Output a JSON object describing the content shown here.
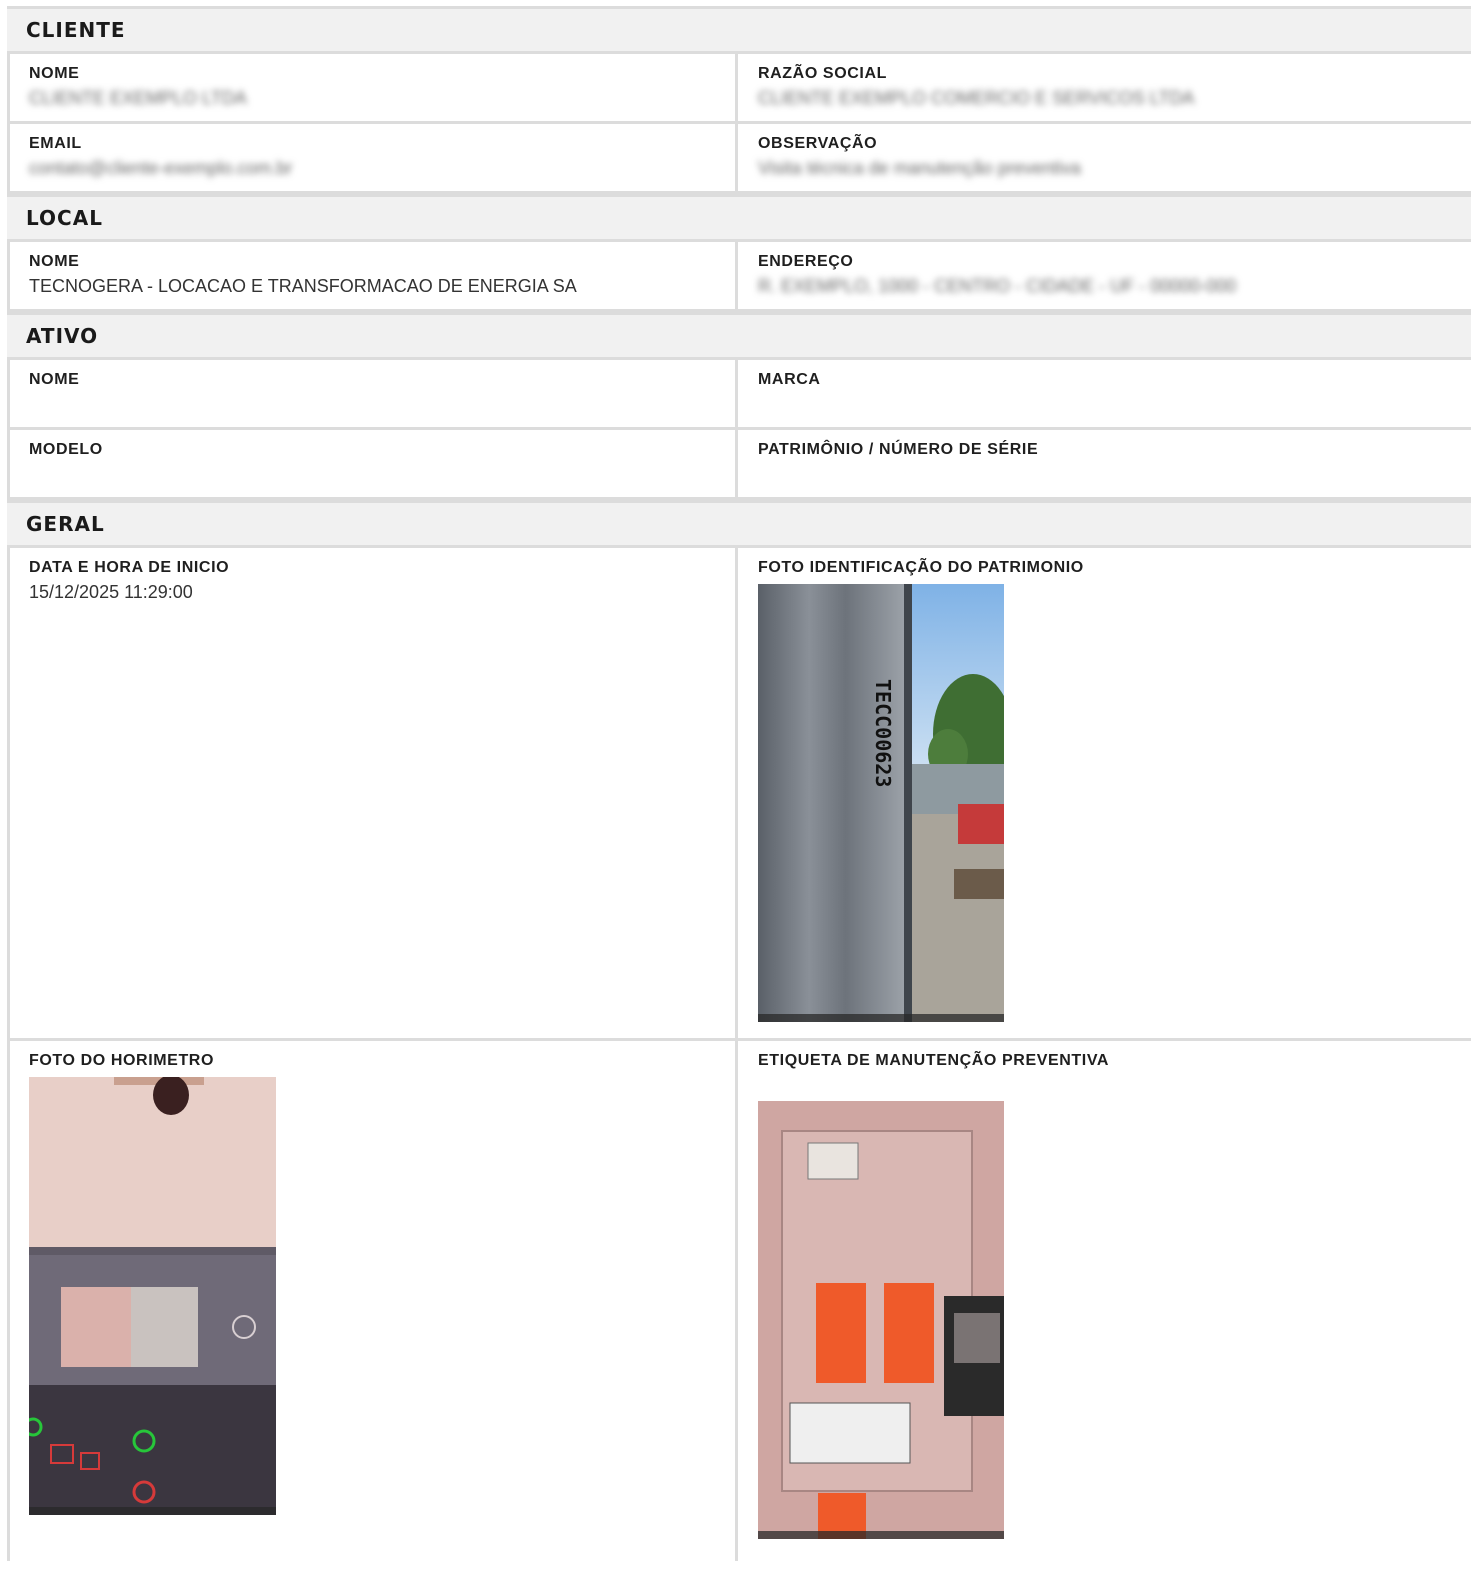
{
  "sections": {
    "cliente": {
      "title": "CLIENTE",
      "nome_label": "NOME",
      "nome_value": "CLIENTE EXEMPLO LTDA",
      "razao_label": "RAZÃO SOCIAL",
      "razao_value": "CLIENTE EXEMPLO COMERCIO E SERVICOS LTDA",
      "email_label": "EMAIL",
      "email_value": "contato@cliente-exemplo.com.br",
      "obs_label": "OBSERVAÇÃO",
      "obs_value": "Visita técnica de manutenção preventiva"
    },
    "local": {
      "title": "LOCAL",
      "nome_label": "NOME",
      "nome_value": "TECNOGERA - LOCACAO E TRANSFORMACAO DE ENERGIA SA",
      "endereco_label": "ENDEREÇO",
      "endereco_value": "R. EXEMPLO, 1000 - CENTRO - CIDADE - UF - 00000-000"
    },
    "ativo": {
      "title": "ATIVO",
      "nome_label": "NOME",
      "marca_label": "MARCA",
      "modelo_label": "MODELO",
      "patrimonio_label": "PATRIMÔNIO / NÚMERO DE SÉRIE"
    },
    "geral": {
      "title": "GERAL",
      "data_label": "DATA E HORA DE INICIO",
      "data_value": "15/12/2025 11:29:00",
      "foto_patrimonio_label": "FOTO IDENTIFICAÇÃO DO PATRIMONIO",
      "foto_patrimonio_text": "TECC00623",
      "foto_horimetro_label": "FOTO DO HORIMETRO",
      "foto_etiqueta_label": "ETIQUETA DE MANUTENÇÃO PREVENTIVA"
    }
  },
  "colors": {
    "header_bg": "#f1f1f1",
    "border": "#dcdcdc"
  }
}
